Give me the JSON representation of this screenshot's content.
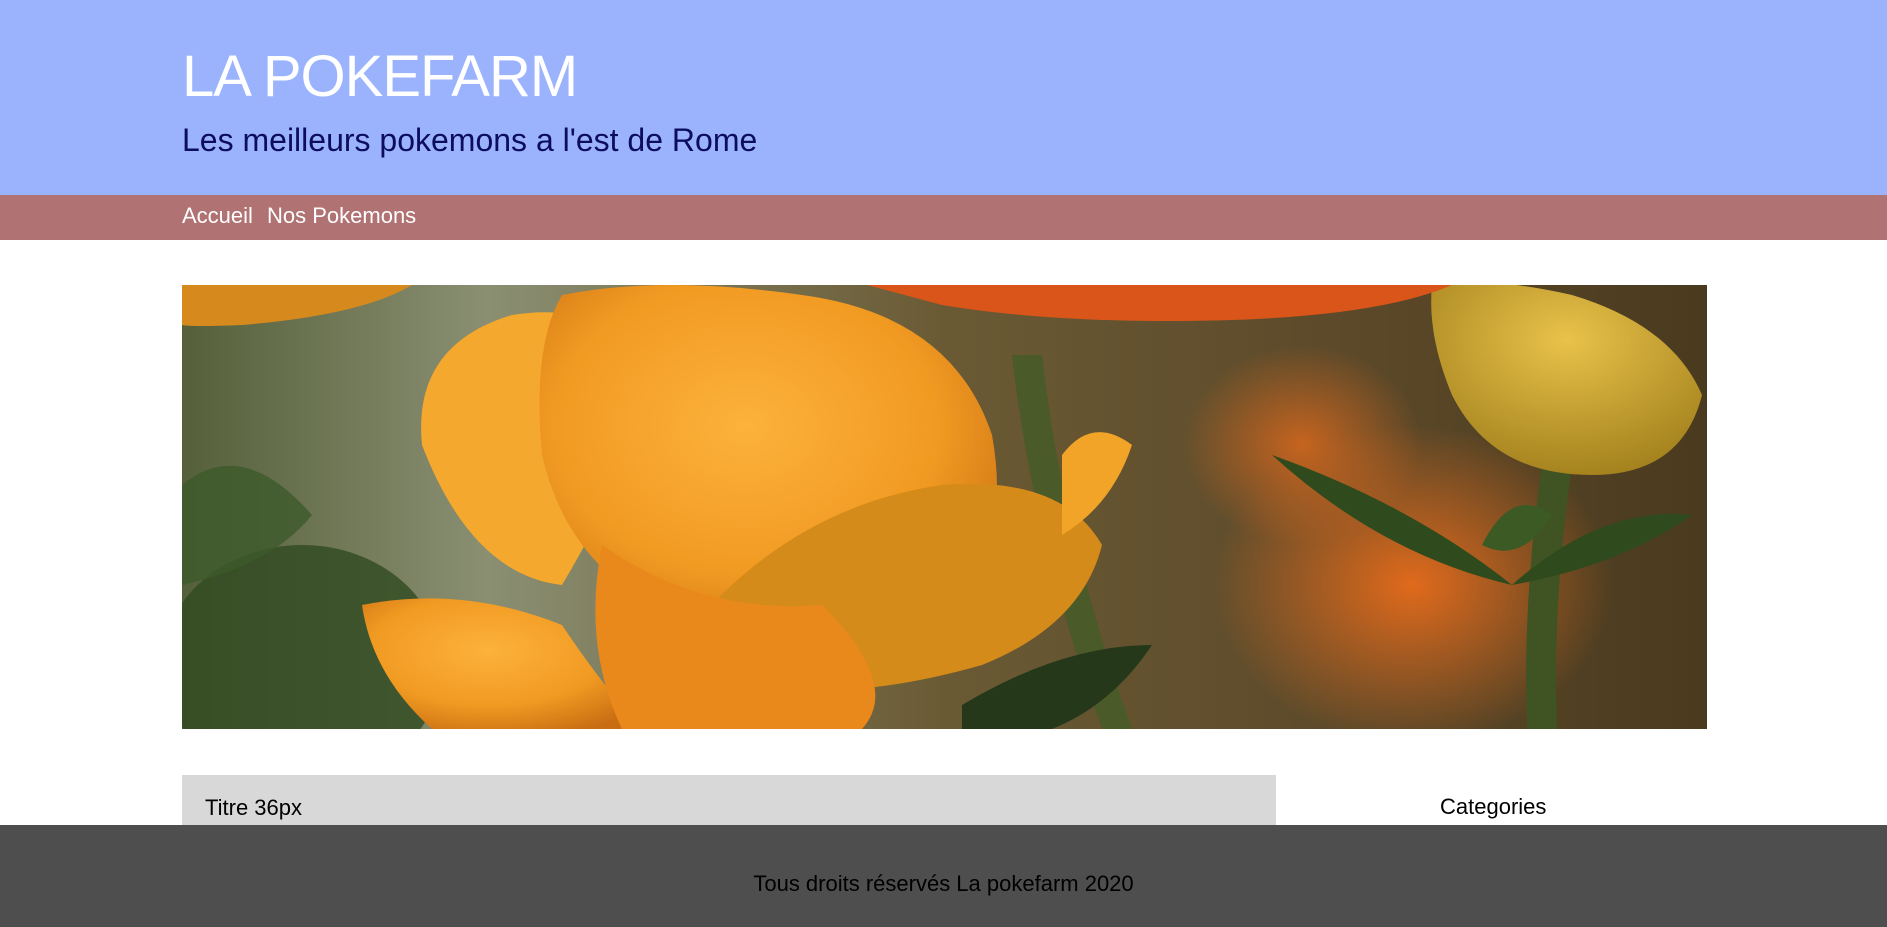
{
  "header": {
    "title": "LA POKEFARM",
    "tagline": "Les meilleurs pokemons a l'est de Rome",
    "background_color": "#9bb3fd"
  },
  "nav": {
    "background_color": "#b07272",
    "items": [
      {
        "label": "Accueil"
      },
      {
        "label": "Nos Pokemons"
      }
    ]
  },
  "hero": {
    "image": "orange-flowers-photo"
  },
  "main": {
    "article_title": "Titre 36px",
    "sidebar_title": "Categories"
  },
  "footer": {
    "text": "Tous droits réservés La pokefarm 2020",
    "background_color": "#4e4e4e"
  }
}
